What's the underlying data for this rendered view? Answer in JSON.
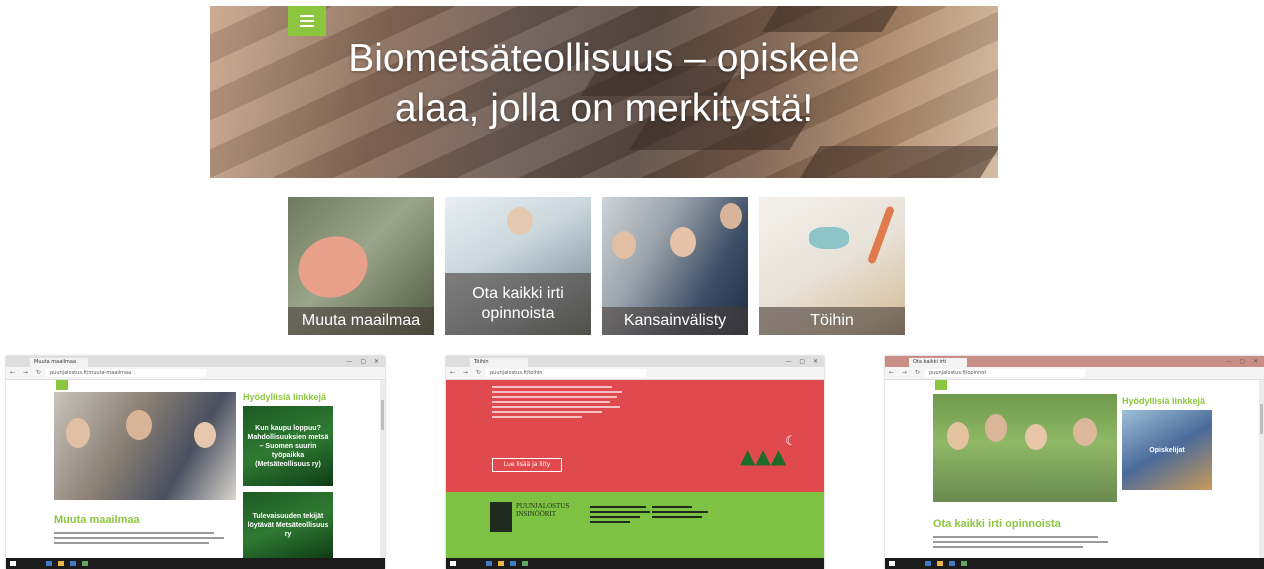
{
  "hero": {
    "title_line1": "Biometsäteollisuus – opiskele",
    "title_line2": "alaa, jolla on merkitystä!"
  },
  "tiles": [
    {
      "label": "Muuta maailmaa"
    },
    {
      "label_line1": "Ota kaikki irti",
      "label_line2": "opinnoista"
    },
    {
      "label": "Kansainvälisty"
    },
    {
      "label": "Töihin"
    }
  ],
  "colors": {
    "accent": "#8cc63f",
    "red_section": "#e04a4f",
    "green_section": "#7dc242",
    "taskbar": "#1b1b1b"
  },
  "windows": [
    {
      "tab_label": "Muuta maailmaa",
      "address": "puunjalostus.fi/muuta-maailmaa",
      "sidebar_title": "Hyödyllisiä linkkejä",
      "card1": "Kun kaupu loppuu? Mahdollisuuksien metsä – Suomen suurin työpaikka (Metsäteollisuus ry)",
      "card2": "Tulevaisuuden tekijät löytävät Metsäteollisuus ry",
      "heading": "Muuta maailmaa"
    },
    {
      "tab_label": "Töihin",
      "address": "puunjalostus.fi/toihin",
      "cta_label": "Lue lisää ja liity",
      "logo_text": "PUUNJALOSTUS INSINÖÖRIT"
    },
    {
      "tab_label": "Ota kaikki irti opinnoista",
      "address": "puunjalostus.fi/opinnot",
      "sidebar_title": "Hyödyllisiä linkkejä",
      "card_label": "Opiskelijat",
      "heading": "Ota kaikki irti opinnoista"
    }
  ],
  "icons": [
    "menu-icon",
    "back-icon",
    "forward-icon",
    "refresh-icon",
    "moon-icon",
    "tree-icon",
    "windows-start-icon"
  ]
}
